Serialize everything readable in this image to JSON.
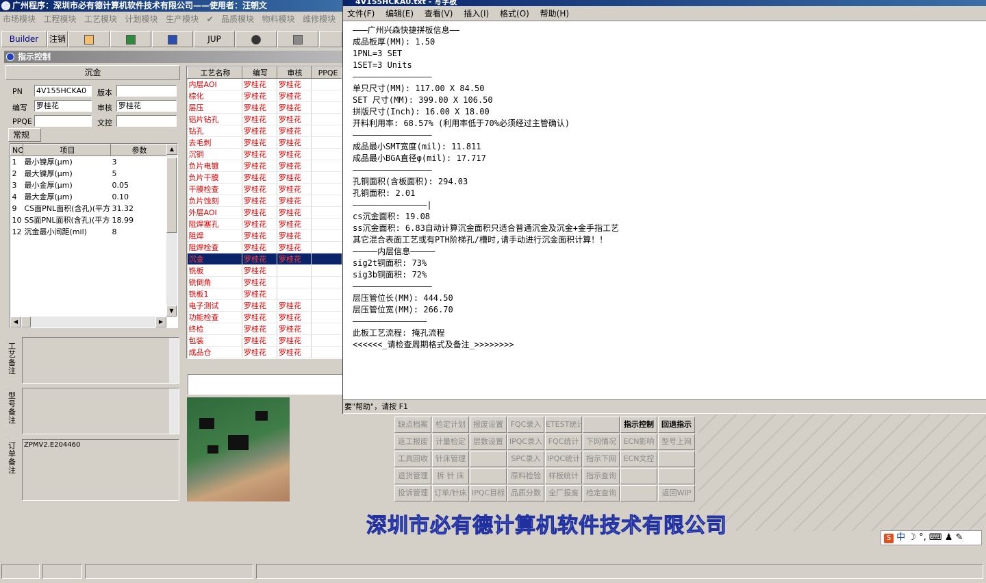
{
  "app": {
    "title": "广州程序：深圳市必有德计算机软件技术有限公司——使用者：汪朝文",
    "modules": [
      "市场模块",
      "工程模块",
      "工艺模块",
      "计划模块",
      "生产模块",
      "品质模块",
      "物料模块",
      "维修模块"
    ],
    "toolbar": {
      "builder": "Builder",
      "logout": "注销",
      "jup": "JUP"
    }
  },
  "panel": {
    "title": "指示控制",
    "process_name": "沉金",
    "labels": {
      "pn": "PN",
      "version": "版本",
      "editor": "编写",
      "reviewer": "审核",
      "ppqe": "PPQE",
      "doc_control": "文控"
    },
    "values": {
      "pn": "4V155HCKA0",
      "version": "",
      "editor": "罗桂花",
      "reviewer": "罗桂花",
      "ppqe": "",
      "doc_control": ""
    },
    "tab": "常规",
    "param_headers": [
      "NO",
      "项目",
      "参数"
    ],
    "params": [
      {
        "no": "1",
        "item": "最小镍厚(μm)",
        "value": "3"
      },
      {
        "no": "2",
        "item": "最大镍厚(μm)",
        "value": "5"
      },
      {
        "no": "3",
        "item": "最小金厚(μm)",
        "value": "0.05"
      },
      {
        "no": "4",
        "item": "最大金厚(μm)",
        "value": "0.10"
      },
      {
        "no": "9",
        "item": "CS面PNL面积(含孔)(平方",
        "value": "31.32"
      },
      {
        "no": "10",
        "item": "SS面PNL面积(含孔)(平方",
        "value": "18.99"
      },
      {
        "no": "12",
        "item": "沉金最小间距(mil)",
        "value": "8"
      }
    ],
    "remarks": {
      "process": "工艺备注",
      "model": "型号备注",
      "order": "订单备注",
      "order_value": "ZPMV2.E204460"
    }
  },
  "process_list": {
    "headers": [
      "工艺名称",
      "编写",
      "审核",
      "PPQE"
    ],
    "rows": [
      {
        "name": "内层AOI",
        "editor": "罗桂花",
        "reviewer": "罗桂花"
      },
      {
        "name": "棕化",
        "editor": "罗桂花",
        "reviewer": "罗桂花"
      },
      {
        "name": "层压",
        "editor": "罗桂花",
        "reviewer": "罗桂花"
      },
      {
        "name": "铝片钻孔",
        "editor": "罗桂花",
        "reviewer": "罗桂花"
      },
      {
        "name": "钻孔",
        "editor": "罗桂花",
        "reviewer": "罗桂花"
      },
      {
        "name": "去毛刺",
        "editor": "罗桂花",
        "reviewer": "罗桂花"
      },
      {
        "name": "沉铜",
        "editor": "罗桂花",
        "reviewer": "罗桂花"
      },
      {
        "name": "负片电镀",
        "editor": "罗桂花",
        "reviewer": "罗桂花"
      },
      {
        "name": "负片干膜",
        "editor": "罗桂花",
        "reviewer": "罗桂花"
      },
      {
        "name": "干膜检查",
        "editor": "罗桂花",
        "reviewer": "罗桂花"
      },
      {
        "name": "负片蚀刻",
        "editor": "罗桂花",
        "reviewer": "罗桂花"
      },
      {
        "name": "外层AOI",
        "editor": "罗桂花",
        "reviewer": "罗桂花"
      },
      {
        "name": "阻焊塞孔",
        "editor": "罗桂花",
        "reviewer": "罗桂花"
      },
      {
        "name": "阻焊",
        "editor": "罗桂花",
        "reviewer": "罗桂花"
      },
      {
        "name": "阻焊检查",
        "editor": "罗桂花",
        "reviewer": "罗桂花"
      },
      {
        "name": "沉金",
        "editor": "罗桂花",
        "reviewer": "罗桂花",
        "selected": true
      },
      {
        "name": "铣板",
        "editor": "罗桂花",
        "reviewer": ""
      },
      {
        "name": "铣倒角",
        "editor": "罗桂花",
        "reviewer": ""
      },
      {
        "name": "铣板1",
        "editor": "罗桂花",
        "reviewer": ""
      },
      {
        "name": "电子测试",
        "editor": "罗桂花",
        "reviewer": "罗桂花"
      },
      {
        "name": "功能检查",
        "editor": "罗桂花",
        "reviewer": "罗桂花"
      },
      {
        "name": "终检",
        "editor": "罗桂花",
        "reviewer": "罗桂花"
      },
      {
        "name": "包装",
        "editor": "罗桂花",
        "reviewer": "罗桂花"
      },
      {
        "name": "成品仓",
        "editor": "罗桂花",
        "reviewer": "罗桂花"
      }
    ]
  },
  "notepad": {
    "title": "4V155HCKA0.txt - 写字板",
    "menu": [
      "文件(F)",
      "编辑(E)",
      "查看(V)",
      "插入(I)",
      "格式(O)",
      "帮助(H)"
    ],
    "lines": [
      "———广州兴森快捷拼板信息——",
      "成品板厚(MM): 1.50",
      "1PNL=3 SET",
      "1SET=3 Units",
      "————————————————",
      "单只尺寸(MM): 117.00 X 84.50",
      "SET 尺寸(MM): 399.00 X 106.50",
      "拼版尺寸(Inch): 16.00 X 18.00",
      "开料利用率: 68.57% (利用率低于70%必须经过主管确认)",
      "————————————————",
      "成品最小SMT宽度(mil): 11.811",
      "成品最小BGA直径φ(mil): 17.717",
      "————————————————",
      "孔铜面积(含板面积): 294.03",
      "孔铜面积: 2.01",
      "———————————————|",
      "cs沉金面积: 19.08",
      "ss沉金面积: 6.83自动计算沉金面积只适合普通沉金及沉金+金手指工艺",
      "其它混合表面工艺或有PTH阶梯孔/槽时,请手动进行沉金面积计算！！",
      "—————内层信息—————",
      "sig2t铜面积: 73%",
      "sig3b铜面积: 72%",
      "————————————————",
      "层压管位长(MM): 444.50",
      "层压管位宽(MM): 266.70",
      "———————————————",
      "此板工艺流程: 掩孔流程",
      "<<<<<<_请检查周期格式及备注_>>>>>>>>"
    ],
    "status": "要\"帮助\"，请按 F1"
  },
  "buttons": [
    [
      "缺点档案",
      "检定计划",
      "报废设置",
      "FQC录入",
      "ETEST统计",
      "",
      "指示控制",
      "回退指示"
    ],
    [
      "返工报废",
      "计量检定",
      "层数设置",
      "IPQC录入",
      "FQC统计",
      "下网情况",
      "ECN影响",
      "型号上网"
    ],
    [
      "工具回收",
      "针床管理",
      "",
      "SPC录入",
      "IPQC统计",
      "指示下网",
      "ECN文控",
      ""
    ],
    [
      "退货管理",
      "拆 针 床",
      "",
      "原料检验",
      "样板统计",
      "指示查询",
      "",
      ""
    ],
    [
      "投诉管理",
      "订单/针床",
      "IPQC目标",
      "品质分数",
      "全厂报废",
      "检定查询",
      "",
      "返回WIP"
    ]
  ],
  "active_buttons": [
    "指示控制",
    "回退指示"
  ],
  "banner": "深圳市必有德计算机软件技术有限公司",
  "ime": {
    "lang": "中"
  }
}
